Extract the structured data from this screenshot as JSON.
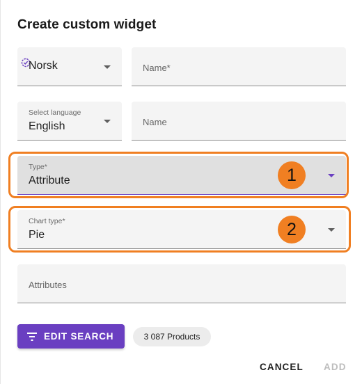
{
  "dialog": {
    "title": "Create custom widget"
  },
  "row1": {
    "language_value": "Norsk",
    "name_placeholder": "Name*"
  },
  "row2": {
    "language_label": "Select language",
    "language_value": "English",
    "name_placeholder": "Name"
  },
  "type_field": {
    "label": "Type*",
    "value": "Attribute"
  },
  "chart_type_field": {
    "label": "Chart type*",
    "value": "Pie"
  },
  "attributes_field": {
    "placeholder": "Attributes"
  },
  "annotations": {
    "marker_1": "1",
    "marker_2": "2",
    "highlight_color": "#f07f22"
  },
  "toolbar": {
    "edit_search_label": "EDIT SEARCH",
    "products_count": "3 087 Products",
    "accent_color": "#6a3fc1"
  },
  "actions": {
    "cancel_label": "CANCEL",
    "add_label": "ADD"
  },
  "icons": {
    "language_check": "check-circle-icon",
    "dropdown": "caret-down-icon",
    "filter": "filter-icon"
  }
}
